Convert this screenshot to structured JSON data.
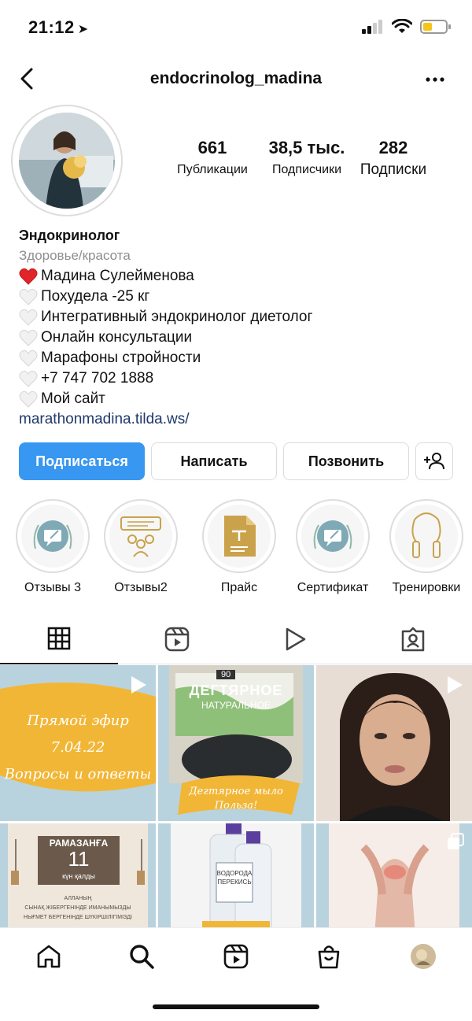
{
  "status_bar": {
    "time": "21:12",
    "icons": [
      "location-arrow-icon",
      "signal-icon",
      "wifi-icon",
      "battery-icon"
    ]
  },
  "header": {
    "username": "endocrinolog_madina",
    "icons": [
      "back-chevron-icon",
      "more-dots-icon"
    ]
  },
  "profile": {
    "stats": [
      {
        "value": "661",
        "label": "Публикации"
      },
      {
        "value": "38,5 тыс.",
        "label": "Подписчики"
      },
      {
        "value": "282",
        "label": "Подписки"
      }
    ],
    "name": "Эндокринолог",
    "category": "Здоровье/красота",
    "bio_lines": [
      {
        "heart": "red",
        "text": "Мадина Сулейменова"
      },
      {
        "heart": "white",
        "text": "Похудела -25 кг"
      },
      {
        "heart": "white",
        "text": "Интегративный эндокринолог диетолог"
      },
      {
        "heart": "white",
        "text": "Онлайн консультации"
      },
      {
        "heart": "white",
        "text": "Марафоны стройности"
      },
      {
        "heart": "white",
        "text": "+7 747 702 1888"
      },
      {
        "heart": "white",
        "text": "Мой сайт"
      }
    ],
    "link": "marathonmadina.tilda.ws/"
  },
  "actions": {
    "follow": "Подписаться",
    "message": "Написать",
    "call": "Позвонить",
    "add_person_icon": "add-person-icon"
  },
  "highlights": [
    {
      "label": "Отзывы 3",
      "icon": "chat-edit-icon"
    },
    {
      "label": "Отзывы2",
      "icon": "group-people-icon"
    },
    {
      "label": "Прайс",
      "icon": "document-icon"
    },
    {
      "label": "Сертификат",
      "icon": "chat-edit-icon"
    },
    {
      "label": "Тренировки",
      "icon": "jump-rope-icon"
    }
  ],
  "tabs": [
    "grid-icon",
    "reels-icon",
    "play-icon",
    "tagged-icon"
  ],
  "grid": {
    "post1": {
      "line1": "Прямой эфир 7.04.22",
      "line2": "Вопросы и ответы"
    },
    "post2": {
      "top": "90",
      "brand": "ДЕГТЯРНОЕ",
      "sub": "НАТУРАЛЬНОЕ",
      "caption1": "Дегтярное мыло",
      "caption2": "Польза!"
    },
    "post4": {
      "title": "РАМАЗАНҒА",
      "number": "11",
      "sub": "күн қалды",
      "text1": "АЛЛАНЫҢ",
      "text2": "СЫНАҚ ЖІБЕРГЕНІНДЕ ИМАНЫМЫЗДЫ",
      "text3": "НЫҒМЕТ БЕРГЕНІНДЕ ШҮКІРШІЛІГІМІЗДІ"
    },
    "post5": {
      "label": "ВОДОРОДА ПЕРЕКИСЬ"
    }
  },
  "bottom_nav": [
    "home-icon",
    "search-icon",
    "reels-icon",
    "shop-icon",
    "profile-avatar"
  ],
  "colors": {
    "primary_blue": "#3897f0",
    "link_blue": "#1f3a6b",
    "highlight_gold": "#c9a24b",
    "highlight_teal": "#7ea9b5",
    "post_yellow": "#f2b636"
  }
}
